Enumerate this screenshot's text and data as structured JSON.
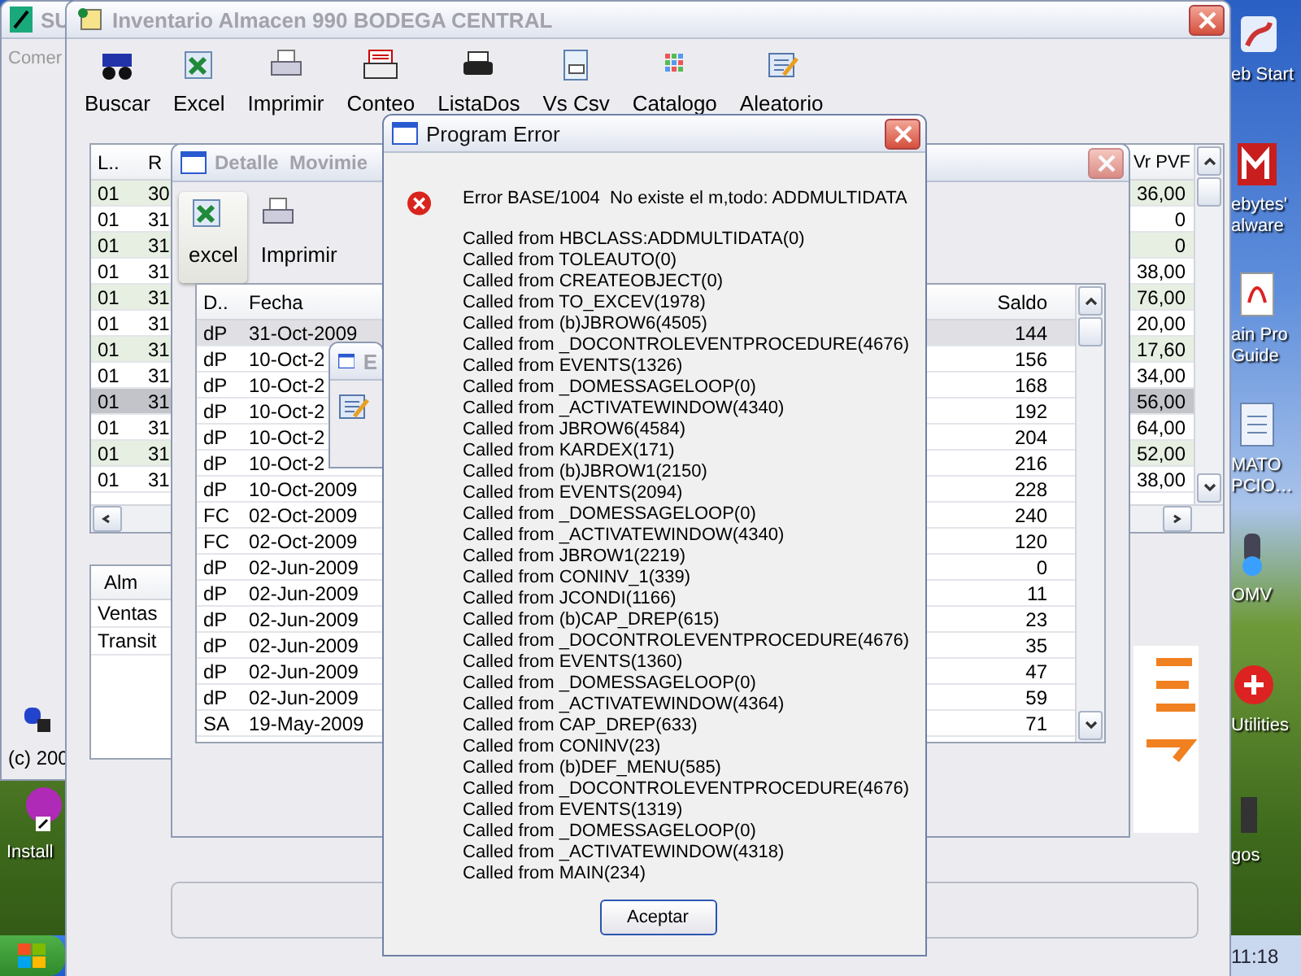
{
  "background_window": {
    "title": "SU",
    "menu": "Comer",
    "status": "(c) 200"
  },
  "desktop": {
    "left_icons": [
      {
        "label": "Install"
      }
    ],
    "right_icons": [
      {
        "label": "eb Start"
      },
      {
        "label": "ebytes'\nalware"
      },
      {
        "label": "ain Pro\nGuide"
      },
      {
        "label": "MATO\nPCIO…"
      },
      {
        "label": "OMV"
      },
      {
        "label": "Utilities"
      },
      {
        "label": "gos"
      }
    ],
    "clock": "11:18"
  },
  "main_window": {
    "title": "Inventario Almacen 990 BODEGA CENTRAL",
    "toolbar": [
      {
        "label": "Buscar"
      },
      {
        "label": "Excel"
      },
      {
        "label": "Imprimir"
      },
      {
        "label": "Conteo"
      },
      {
        "label": "ListaDos"
      },
      {
        "label": "Vs Csv"
      },
      {
        "label": "Catalogo"
      },
      {
        "label": "Aleatorio"
      }
    ],
    "table": {
      "columns": [
        "L..",
        "R",
        "Vr PVF"
      ],
      "rows": [
        {
          "cells": [
            "01",
            "30",
            "36,00"
          ],
          "selected": false
        },
        {
          "cells": [
            "01",
            "31",
            "0"
          ],
          "selected": false
        },
        {
          "cells": [
            "01",
            "31",
            "0"
          ],
          "selected": false
        },
        {
          "cells": [
            "01",
            "31",
            "38,00"
          ],
          "selected": false
        },
        {
          "cells": [
            "01",
            "31",
            "76,00"
          ],
          "selected": false
        },
        {
          "cells": [
            "01",
            "31",
            "20,00"
          ],
          "selected": false
        },
        {
          "cells": [
            "01",
            "31",
            "17,60"
          ],
          "selected": false
        },
        {
          "cells": [
            "01",
            "31",
            "34,00"
          ],
          "selected": false
        },
        {
          "cells": [
            "01",
            "31",
            "56,00"
          ],
          "selected": true
        },
        {
          "cells": [
            "01",
            "31",
            "64,00"
          ],
          "selected": false
        },
        {
          "cells": [
            "01",
            "31",
            "52,00"
          ],
          "selected": false
        },
        {
          "cells": [
            "01",
            "31",
            "38,00"
          ],
          "selected": false
        }
      ]
    },
    "summary": {
      "column": "Alm",
      "rows": [
        "Ventas",
        "Transit"
      ]
    }
  },
  "detail_window": {
    "title": "Detalle  Movimie",
    "toolbar": [
      {
        "label": "excel"
      },
      {
        "label": "Imprimir"
      }
    ],
    "table": {
      "columns": [
        "D..",
        "Fecha",
        "Saldo"
      ],
      "rows": [
        {
          "cells": [
            "dP",
            "31-Oct-2009",
            "144"
          ],
          "selected": true
        },
        {
          "cells": [
            "dP",
            "10-Oct-2",
            "156"
          ],
          "selected": false
        },
        {
          "cells": [
            "dP",
            "10-Oct-2",
            "168"
          ],
          "selected": false
        },
        {
          "cells": [
            "dP",
            "10-Oct-2",
            "192"
          ],
          "selected": false
        },
        {
          "cells": [
            "dP",
            "10-Oct-2",
            "204"
          ],
          "selected": false
        },
        {
          "cells": [
            "dP",
            "10-Oct-2",
            "216"
          ],
          "selected": false
        },
        {
          "cells": [
            "dP",
            "10-Oct-2009",
            "228"
          ],
          "selected": false
        },
        {
          "cells": [
            "FC",
            "02-Oct-2009",
            "240"
          ],
          "selected": false
        },
        {
          "cells": [
            "FC",
            "02-Oct-2009",
            "120"
          ],
          "selected": false
        },
        {
          "cells": [
            "dP",
            "02-Jun-2009",
            "0"
          ],
          "selected": false
        },
        {
          "cells": [
            "dP",
            "02-Jun-2009",
            "11"
          ],
          "selected": false
        },
        {
          "cells": [
            "dP",
            "02-Jun-2009",
            "23"
          ],
          "selected": false
        },
        {
          "cells": [
            "dP",
            "02-Jun-2009",
            "35"
          ],
          "selected": false
        },
        {
          "cells": [
            "dP",
            "02-Jun-2009",
            "47"
          ],
          "selected": false
        },
        {
          "cells": [
            "dP",
            "02-Jun-2009",
            "59"
          ],
          "selected": false
        },
        {
          "cells": [
            "SA",
            "19-May-2009",
            "71"
          ],
          "selected": false
        }
      ]
    }
  },
  "small_window": {
    "title": "E"
  },
  "error_dialog": {
    "title": "Program Error",
    "message": "Error BASE/1004  No existe el m,todo: ADDMULTIDATA",
    "calls": [
      "Called from HBCLASS:ADDMULTIDATA(0)",
      "Called from TOLEAUTO(0)",
      "Called from CREATEOBJECT(0)",
      "Called from TO_EXCEV(1978)",
      "Called from (b)JBROW6(4505)",
      "Called from _DOCONTROLEVENTPROCEDURE(4676)",
      "Called from EVENTS(1326)",
      "Called from _DOMESSAGELOOP(0)",
      "Called from _ACTIVATEWINDOW(4340)",
      "Called from JBROW6(4584)",
      "Called from KARDEX(171)",
      "Called from (b)JBROW1(2150)",
      "Called from EVENTS(2094)",
      "Called from _DOMESSAGELOOP(0)",
      "Called from _ACTIVATEWINDOW(4340)",
      "Called from JBROW1(2219)",
      "Called from CONINV_1(339)",
      "Called from JCONDI(1166)",
      "Called from (b)CAP_DREP(615)",
      "Called from _DOCONTROLEVENTPROCEDURE(4676)",
      "Called from EVENTS(1360)",
      "Called from _DOMESSAGELOOP(0)",
      "Called from _ACTIVATEWINDOW(4364)",
      "Called from CAP_DREP(633)",
      "Called from CONINV(23)",
      "Called from (b)DEF_MENU(585)",
      "Called from _DOCONTROLEVENTPROCEDURE(4676)",
      "Called from EVENTS(1319)",
      "Called from _DOMESSAGELOOP(0)",
      "Called from _ACTIVATEWINDOW(4318)",
      "Called from MAIN(234)"
    ],
    "button": "Aceptar"
  }
}
